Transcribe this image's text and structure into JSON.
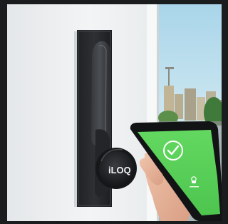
{
  "scene": {
    "subject": "smart-lock-with-phone",
    "brand_text": "iLOQ",
    "phone_status_text": "ᕈ",
    "phone_status_caption": "———",
    "colors": {
      "frame_dark": "#1b1c1e",
      "wall": "#eef0f1",
      "wall_shadow": "#d9dcdf",
      "lock_body": "#2b2d30",
      "lock_plate": "#232528",
      "lock_highlight": "#4a4d52",
      "sky": "#bfe1ef",
      "city": "#b9b39f",
      "phone_screen": "#5cd35b",
      "phone_body": "#17181a",
      "hand": "#e6b49a",
      "check_white": "#ffffff"
    },
    "icons": {
      "checkmark": "check-circle-icon",
      "lock_key": "lock-key-icon"
    }
  }
}
